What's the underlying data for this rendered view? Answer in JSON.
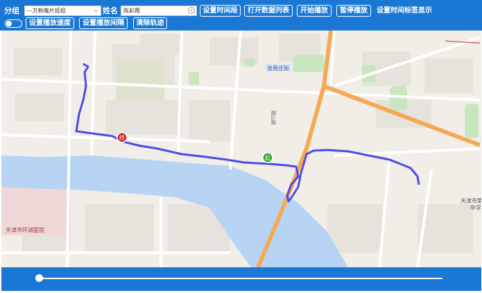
{
  "toolbar": {
    "group_label": "分组",
    "group_select_value": "---万新庵片班组",
    "name_label": "姓名",
    "name_input_value": "陈彩霞",
    "set_time_range": "设置时间段",
    "open_data_list": "打开数据列表",
    "start_play": "开始播放",
    "pause_play": "暂停播放",
    "set_time_label_display": "设置时间标签显示",
    "set_play_speed": "设置播放速度",
    "set_play_interval": "设置播放间隔",
    "clear_track": "清除轨迹"
  },
  "map": {
    "labels": {
      "street": "张贵庄街",
      "road": "福山路",
      "hospital": "天津市环湖医院",
      "right_place_1": "天津市第",
      "right_place_2": "中学",
      "start_marker": "起",
      "end_marker": "终"
    },
    "colors": {
      "track": "#4b4be8",
      "river": "#b8d4f4",
      "main_road": "#f5a955",
      "park": "#c8e6c0",
      "start": "#2ba02b",
      "end": "#cc2222"
    }
  },
  "playback": {
    "progress": 0
  }
}
